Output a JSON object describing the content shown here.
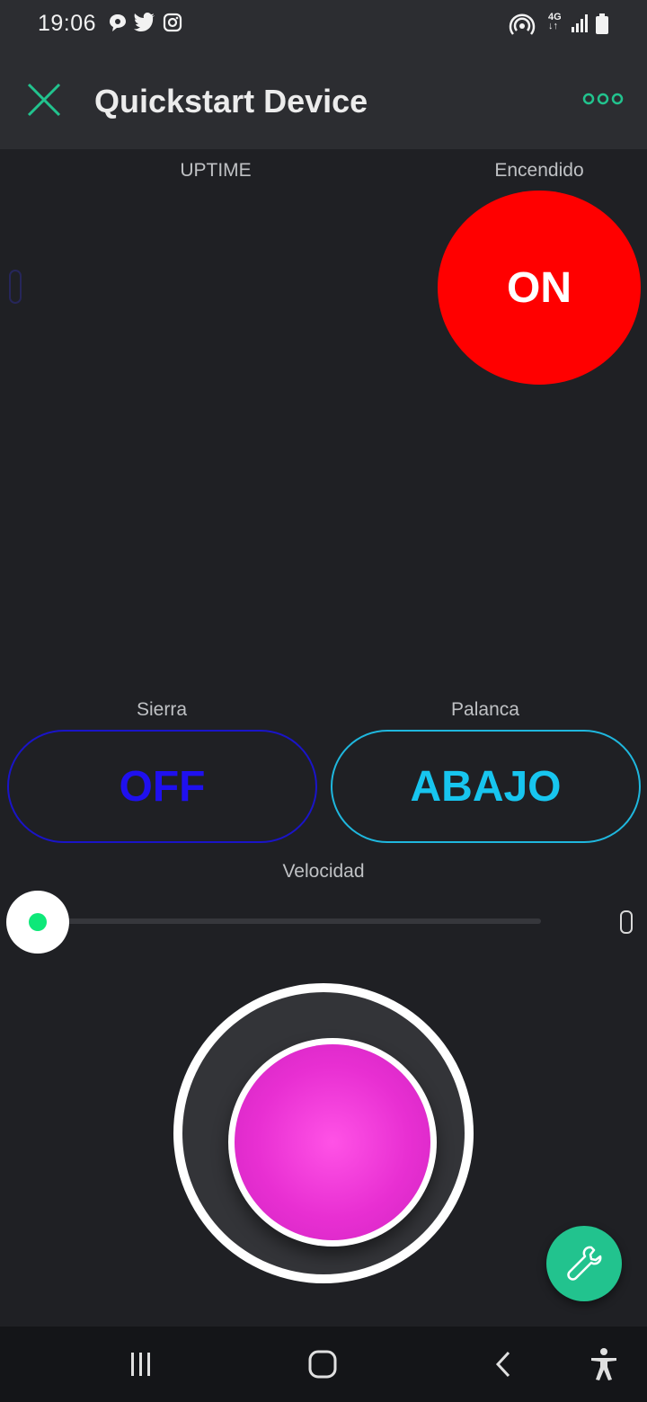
{
  "status_bar": {
    "time": "19:06",
    "left_icons": [
      "chat-icon",
      "twitter-icon",
      "instagram-icon"
    ],
    "right_icons": [
      "hotspot-icon",
      "network-4g-icon",
      "signal-icon",
      "battery-icon"
    ],
    "network_label": "4G"
  },
  "app_bar": {
    "title": "Quickstart Device",
    "close_icon": "close-icon",
    "more_icon": "more-options-icon"
  },
  "widgets": {
    "uptime": {
      "label": "UPTIME"
    },
    "encendido": {
      "label": "Encendido",
      "value": "ON",
      "color": "#ff0000"
    },
    "sierra": {
      "label": "Sierra",
      "value": "OFF",
      "color": "#1f10ef"
    },
    "palanca": {
      "label": "Palanca",
      "value": "ABAJO",
      "color": "#17c5ef"
    },
    "velocidad": {
      "label": "Velocidad",
      "level": 0,
      "accent": "#0ee879"
    },
    "joystick": {
      "color": "#e82fd2"
    }
  },
  "fab": {
    "icon": "wrench-icon",
    "color": "#22c38e"
  },
  "nav_bar": {
    "icons": [
      "recent-apps-icon",
      "home-icon",
      "back-icon",
      "accessibility-icon"
    ]
  },
  "colors": {
    "accent": "#22c38e",
    "background": "#1f2024",
    "app_bar": "#2c2d31"
  }
}
